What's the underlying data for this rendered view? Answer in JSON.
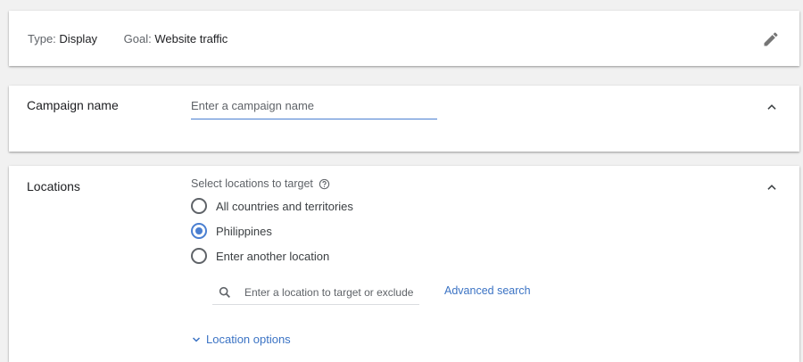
{
  "summary": {
    "type_key": "Type:",
    "type_value": "Display",
    "goal_key": "Goal:",
    "goal_value": "Website traffic"
  },
  "campaign_name": {
    "label": "Campaign name",
    "placeholder": "Enter a campaign name",
    "value": ""
  },
  "locations": {
    "label": "Locations",
    "select_title": "Select locations to target",
    "options": [
      {
        "label": "All countries and territories",
        "selected": false
      },
      {
        "label": "Philippines",
        "selected": true
      },
      {
        "label": "Enter another location",
        "selected": false
      }
    ],
    "search_placeholder": "Enter a location to target or exclude",
    "advanced_search": "Advanced search",
    "location_options": "Location options"
  },
  "icons": {
    "edit": "pencil-icon",
    "collapse": "chevron-up-icon",
    "help": "help-circle-icon",
    "search": "search-icon",
    "expand": "chevron-down-icon"
  },
  "colors": {
    "accent": "#4a7fd1",
    "link": "#3b73c4",
    "muted": "#5f6368",
    "background": "#f1f1f1"
  }
}
